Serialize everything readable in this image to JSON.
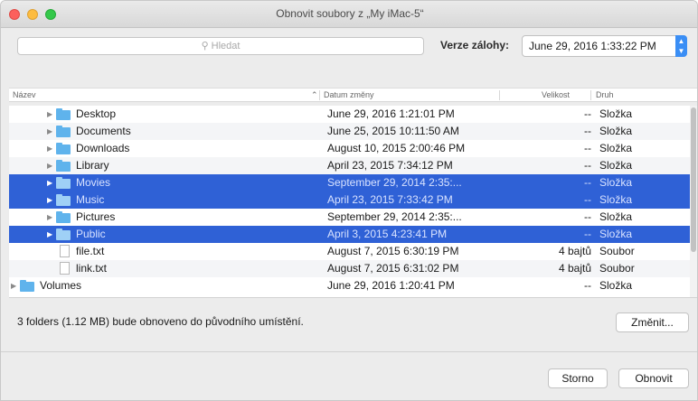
{
  "window": {
    "title": "Obnovit soubory z „My iMac-5“"
  },
  "toolbar": {
    "search_placeholder": "Hledat",
    "version_label": "Verze zálohy:",
    "version_value": "June 29, 2016 1:33:22 PM"
  },
  "columns": {
    "name": "Název",
    "date": "Datum změny",
    "size": "Velikost",
    "kind": "Druh"
  },
  "rows": [
    {
      "name": "Desktop",
      "date": "June 29, 2016 1:21:01 PM",
      "size": "--",
      "kind": "Složka"
    },
    {
      "name": "Documents",
      "date": "June 25, 2015 10:11:50 AM",
      "size": "--",
      "kind": "Složka"
    },
    {
      "name": "Downloads",
      "date": "August 10, 2015 2:00:46 PM",
      "size": "--",
      "kind": "Složka"
    },
    {
      "name": "Library",
      "date": "April 23, 2015 7:34:12 PM",
      "size": "--",
      "kind": "Složka"
    },
    {
      "name": "Movies",
      "date": "September 29, 2014 2:35:...",
      "size": "--",
      "kind": "Složka"
    },
    {
      "name": "Music",
      "date": "April 23, 2015 7:33:42 PM",
      "size": "--",
      "kind": "Složka"
    },
    {
      "name": "Pictures",
      "date": "September 29, 2014 2:35:...",
      "size": "--",
      "kind": "Složka"
    },
    {
      "name": "Public",
      "date": "April 3, 2015 4:23:41 PM",
      "size": "--",
      "kind": "Složka"
    },
    {
      "name": "file.txt",
      "date": "August 7, 2015 6:30:19 PM",
      "size": "4 bajtů",
      "kind": "Soubor"
    },
    {
      "name": "link.txt",
      "date": "August 7, 2015 6:31:02 PM",
      "size": "4 bajtů",
      "kind": "Soubor"
    },
    {
      "name": "Volumes",
      "date": "June 29, 2016 1:20:41 PM",
      "size": "--",
      "kind": "Složka"
    }
  ],
  "status_text": "3 folders (1.12 MB) bude obnoveno do původního umístění.",
  "buttons": {
    "change": "Změnit...",
    "cancel": "Storno",
    "restore": "Obnovit"
  }
}
